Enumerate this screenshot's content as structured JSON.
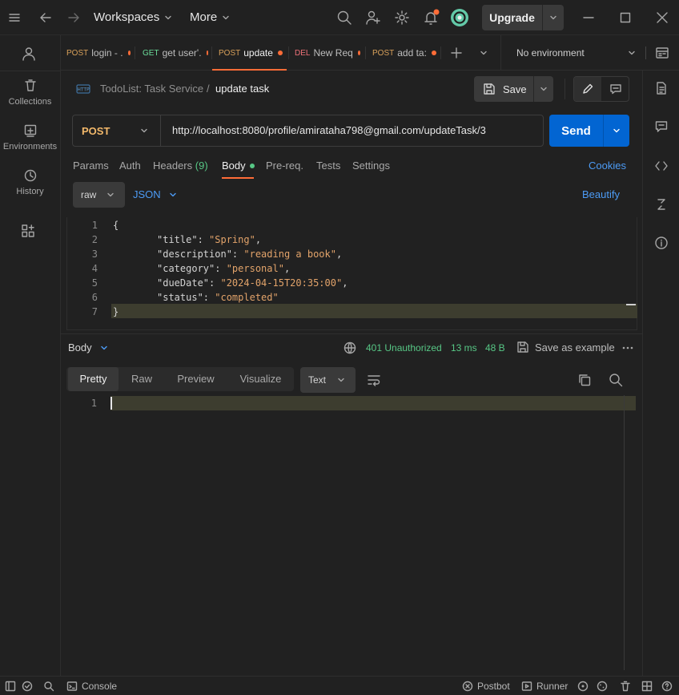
{
  "titlebar": {
    "workspaces_label": "Workspaces",
    "more_label": "More",
    "upgrade_label": "Upgrade"
  },
  "sidebar": {
    "items": [
      {
        "label": "Collections"
      },
      {
        "label": "Environments"
      },
      {
        "label": "History"
      }
    ]
  },
  "tabs": [
    {
      "method": "POST",
      "method_color": "#d9a15a",
      "name": "login - ."
    },
    {
      "method": "GET",
      "method_color": "#6bdd9a",
      "name": "get user'."
    },
    {
      "method": "POST",
      "method_color": "#d9a15a",
      "name": "update"
    },
    {
      "method": "DEL",
      "method_color": "#f07178",
      "name": "New Req"
    },
    {
      "method": "POST",
      "method_color": "#d9a15a",
      "name": "add ta:"
    }
  ],
  "environment": {
    "selected": "No environment"
  },
  "breadcrumb": {
    "collection": "TodoList: Task Service",
    "separator": "/",
    "request": "update task"
  },
  "actions": {
    "save_label": "Save"
  },
  "request": {
    "method": "POST",
    "url": "http://localhost:8080/profile/amirataha798@gmail.com/updateTask/3",
    "send_label": "Send"
  },
  "request_tabs": {
    "params": "Params",
    "auth": "Auth",
    "headers": "Headers",
    "headers_count": "(9)",
    "body": "Body",
    "prereq": "Pre-req.",
    "tests": "Tests",
    "settings": "Settings",
    "cookies": "Cookies"
  },
  "body_options": {
    "mode": "raw",
    "format": "JSON",
    "beautify": "Beautify"
  },
  "editor": {
    "line_numbers": [
      "1",
      "2",
      "3",
      "4",
      "5",
      "6",
      "7"
    ],
    "open_brace": "{",
    "close_brace": "}",
    "fields": [
      {
        "key": "\"title\"",
        "value": "\"Spring\"",
        "trail": ","
      },
      {
        "key": "\"description\"",
        "value": "\"reading a book\"",
        "trail": ","
      },
      {
        "key": "\"category\"",
        "value": "\"personal\"",
        "trail": ","
      },
      {
        "key": "\"dueDate\"",
        "value": "\"2024-04-15T20:35:00\"",
        "trail": ","
      },
      {
        "key": "\"status\"",
        "value": "\"completed\"",
        "trail": ""
      }
    ]
  },
  "response": {
    "section_label": "Body",
    "status": "401 Unauthorized",
    "time": "13 ms",
    "size": "48 B",
    "save_example": "Save as example",
    "views": [
      "Pretty",
      "Raw",
      "Preview",
      "Visualize"
    ],
    "format": "Text",
    "line_numbers": [
      "1"
    ]
  },
  "statusbar": {
    "console": "Console",
    "postbot": "Postbot",
    "runner": "Runner"
  },
  "colors": {
    "accent": "#0265d2",
    "status_ok": "#57c785",
    "link": "#4c9bf5",
    "post": "#d9a15a",
    "dot": "#ff6c37"
  }
}
